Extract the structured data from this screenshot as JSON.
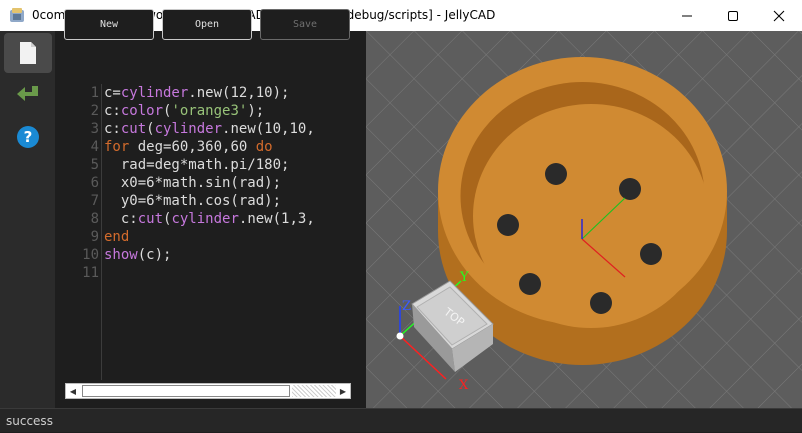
{
  "window": {
    "title": "0composite.lua[D:/workspace/JellyCAD/cmake-build-debug/scripts] - JellyCAD",
    "app_icon": "jellycad-app-icon",
    "controls": [
      "minimize-icon",
      "maximize-icon",
      "close-icon"
    ]
  },
  "activity_bar": {
    "items": [
      {
        "icon": "file-icon",
        "active": true
      },
      {
        "icon": "run-arrow-icon",
        "active": false
      },
      {
        "icon": "help-icon",
        "active": false
      }
    ]
  },
  "toolbar": {
    "new_label": "New",
    "open_label": "Open",
    "save_label": "Save",
    "save_enabled": false
  },
  "editor": {
    "line_numbers": [
      "1",
      "2",
      "3",
      "4",
      "5",
      "6",
      "7",
      "8",
      "9",
      "10",
      "11"
    ],
    "lines": [
      "c=cylinder.new(12,10);",
      "c:color('orange3');",
      "c:cut(cylinder.new(10,10,",
      "for deg=60,360,60 do",
      "  rad=deg*math.pi/180;",
      "  x0=6*math.sin(rad);",
      "  y0=6*math.cos(rad);",
      "  c:cut(cylinder.new(1,3,",
      "end",
      "show(c);",
      ""
    ],
    "colors": {
      "keyword": "#d36b2c",
      "function": "#c678dd",
      "string": "#98c379",
      "text": "#dcdcdc"
    }
  },
  "viewport": {
    "model_color": "#c8862e",
    "view_cube": {
      "face_label": "TOP"
    },
    "axes": {
      "x_label": "X",
      "y_label": "Y",
      "z_label": "Z"
    }
  },
  "status": {
    "text": "success"
  }
}
